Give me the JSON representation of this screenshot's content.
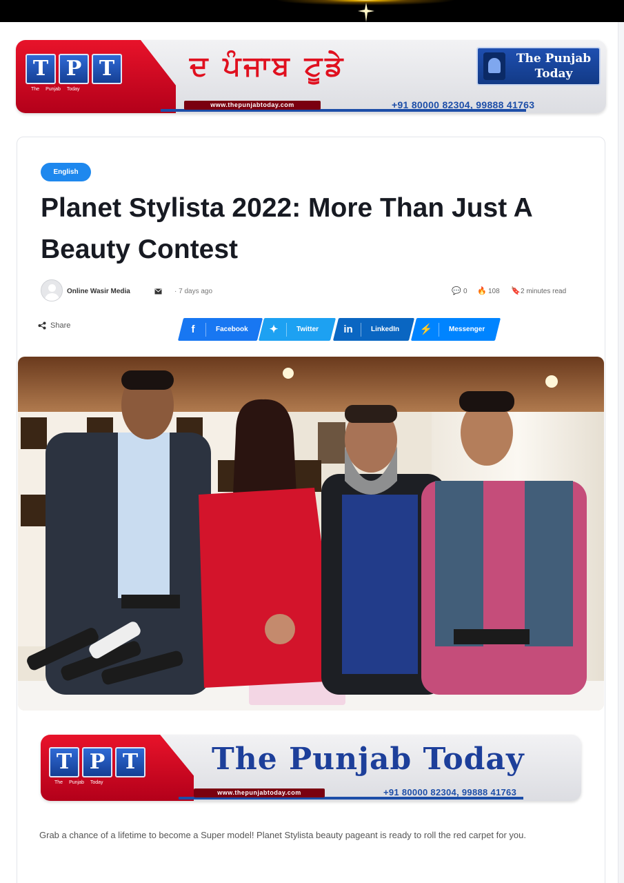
{
  "top_banner": {
    "tpt_letters": [
      "T",
      "P",
      "T"
    ],
    "tpt_subs": [
      "The",
      "Punjab",
      "Today"
    ],
    "title_punjabi": "ਦ ਪੰਜਾਬ ਟੂਡੇ",
    "logo_text": "The Punjab Today",
    "url_strip": "www.thepunjabtoday.com",
    "phone": "+91 80000 82304, 99888 41763"
  },
  "article": {
    "category": "English",
    "title": "Planet Stylista 2022: More Than Just A Beauty Contest",
    "author": "Online Wasir Media",
    "date": "7 days ago",
    "comments": "0",
    "views": "108",
    "read_time": "2 minutes read",
    "share_label": "Share",
    "share_buttons": [
      {
        "label": "Facebook",
        "icon": "facebook-icon",
        "color": "#1877f2"
      },
      {
        "label": "Twitter",
        "icon": "twitter-icon",
        "color": "#1da1f2"
      },
      {
        "label": "LinkedIn",
        "icon": "linkedin-icon",
        "color": "#0a66c2"
      },
      {
        "label": "Messenger",
        "icon": "messenger-icon",
        "color": "#0084ff"
      }
    ],
    "intro": "Grab a chance of a lifetime to become a Super model! Planet Stylista beauty pageant is ready to roll the red carpet for you."
  },
  "inline_banner": {
    "tpt_letters": [
      "T",
      "P",
      "T"
    ],
    "tpt_subs": [
      "The",
      "Punjab",
      "Today"
    ],
    "title": "The Punjab Today",
    "url_strip": "www.thepunjabtoday.com",
    "phone": "+91 80000 82304, 99888 41763"
  },
  "colors": {
    "brand_red": "#e0101f",
    "brand_blue": "#1d4ea8",
    "category_badge": "#1e88ee"
  }
}
